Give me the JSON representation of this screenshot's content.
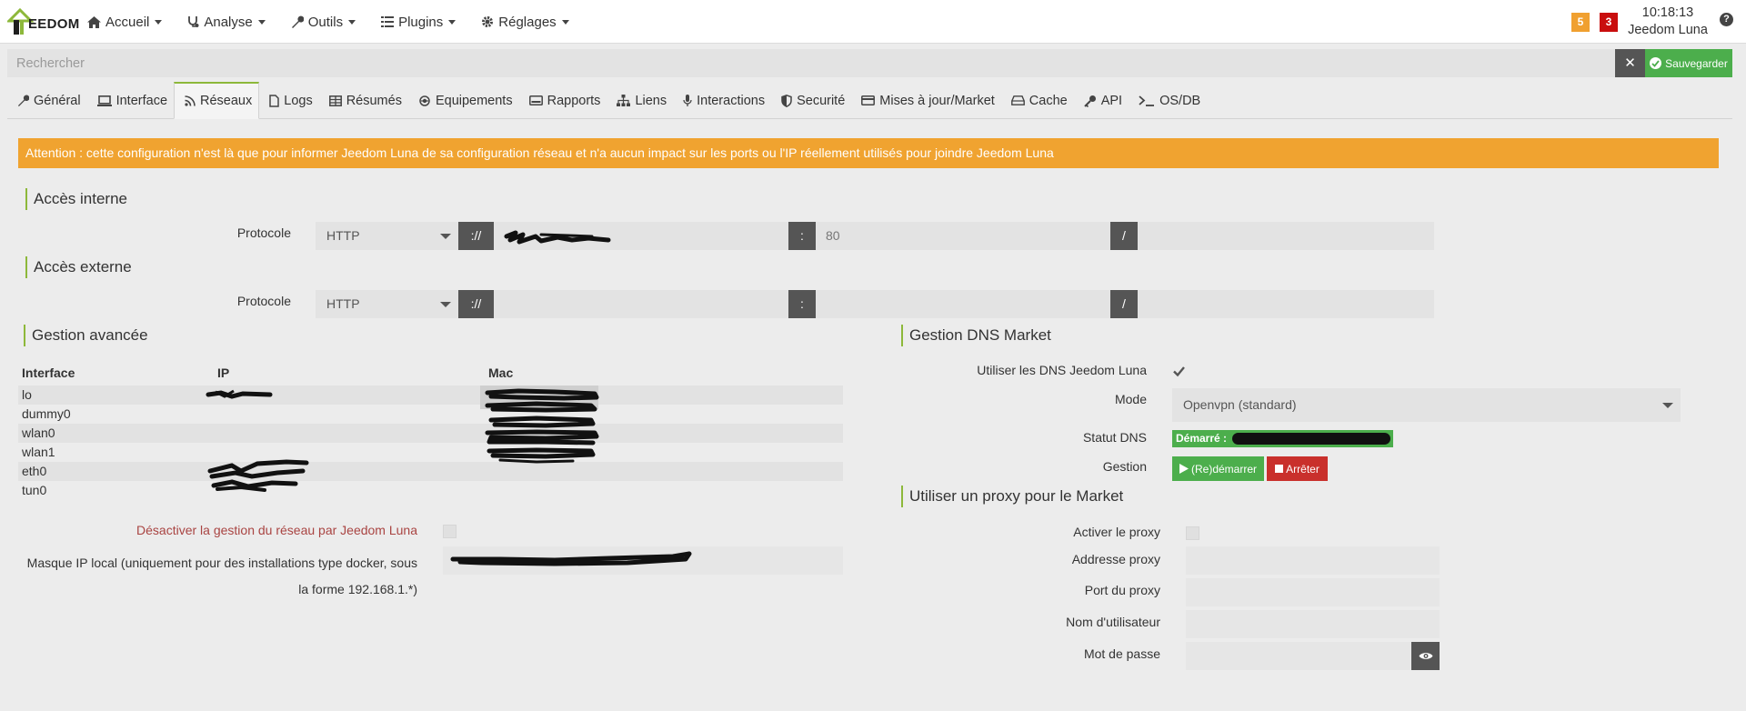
{
  "navbar": {
    "logo_text": "EEDOM",
    "menu": [
      {
        "label": "Accueil",
        "icon": "home-icon"
      },
      {
        "label": "Analyse",
        "icon": "stethoscope-icon"
      },
      {
        "label": "Outils",
        "icon": "wrench-icon"
      },
      {
        "label": "Plugins",
        "icon": "list-icon"
      },
      {
        "label": "Réglages",
        "icon": "gear-icon"
      }
    ],
    "badge_warning": "5",
    "badge_danger": "3",
    "time": "10:18:13",
    "hostname": "Jeedom Luna",
    "help": "?"
  },
  "search": {
    "placeholder": "Rechercher",
    "value": "",
    "save_label": "Sauvegarder"
  },
  "tabs": [
    {
      "label": "Général",
      "icon": "wrench-icon",
      "active": false
    },
    {
      "label": "Interface",
      "icon": "laptop-icon",
      "active": false
    },
    {
      "label": "Réseaux",
      "icon": "rss-icon",
      "active": true
    },
    {
      "label": "Logs",
      "icon": "file-icon",
      "active": false
    },
    {
      "label": "Résumés",
      "icon": "table-icon",
      "active": false
    },
    {
      "label": "Equipements",
      "icon": "cogs-icon",
      "active": false
    },
    {
      "label": "Rapports",
      "icon": "hdd-icon",
      "active": false
    },
    {
      "label": "Liens",
      "icon": "sitemap-icon",
      "active": false
    },
    {
      "label": "Interactions",
      "icon": "microphone-icon",
      "active": false
    },
    {
      "label": "Securité",
      "icon": "shield-icon",
      "active": false
    },
    {
      "label": "Mises à jour/Market",
      "icon": "credit-card-icon",
      "active": false
    },
    {
      "label": "Cache",
      "icon": "hdd-o-icon",
      "active": false
    },
    {
      "label": "API",
      "icon": "key-icon",
      "active": false
    },
    {
      "label": "OS/DB",
      "icon": "terminal-icon",
      "active": false
    }
  ],
  "alert": "Attention : cette configuration n'est là que pour informer Jeedom Luna de sa configuration réseau et n'a aucun impact sur les ports ou l'IP réellement utilisés pour joindre Jeedom Luna",
  "internal": {
    "title": "Accès interne",
    "protocol_label": "Protocole",
    "protocol": "HTTP",
    "sep_scheme": "://",
    "sep_port": ":",
    "port": "80",
    "sep_path": "/",
    "path": ""
  },
  "external": {
    "title": "Accès externe",
    "protocol_label": "Protocole",
    "protocol": "HTTP",
    "sep_scheme": "://",
    "address": "",
    "sep_port": ":",
    "port": "",
    "sep_path": "/",
    "path": ""
  },
  "advanced": {
    "title": "Gestion avancée",
    "columns": [
      "Interface",
      "IP",
      "Mac"
    ],
    "rows": [
      "lo",
      "dummy0",
      "wlan0",
      "wlan1",
      "eth0",
      "tun0"
    ],
    "disable_label": "Désactiver la gestion du réseau par Jeedom Luna",
    "disable_checked": false,
    "mask_label_line1": "Masque IP local (uniquement pour des installations type docker, sous",
    "mask_label_line2": "la forme 192.168.1.*)"
  },
  "dns": {
    "title": "Gestion DNS Market",
    "use_label": "Utiliser les DNS Jeedom Luna",
    "use_checked": true,
    "mode_label": "Mode",
    "mode_value": "Openvpn (standard)",
    "status_label": "Statut DNS",
    "status_value": "Démarré :",
    "manage_label": "Gestion",
    "restart_label": "(Re)démarrer",
    "stop_label": "Arrêter"
  },
  "proxy": {
    "title": "Utiliser un proxy pour le Market",
    "enable_label": "Activer le proxy",
    "enable_checked": false,
    "address_label": "Addresse proxy",
    "address": "",
    "port_label": "Port du proxy",
    "port": "",
    "user_label": "Nom d'utilisateur",
    "user": "",
    "password_label": "Mot de passe",
    "password": ""
  },
  "colors": {
    "accent_green": "#8db83a",
    "success": "#4cae4c",
    "danger": "#c9302c",
    "warning": "#f0a330"
  }
}
